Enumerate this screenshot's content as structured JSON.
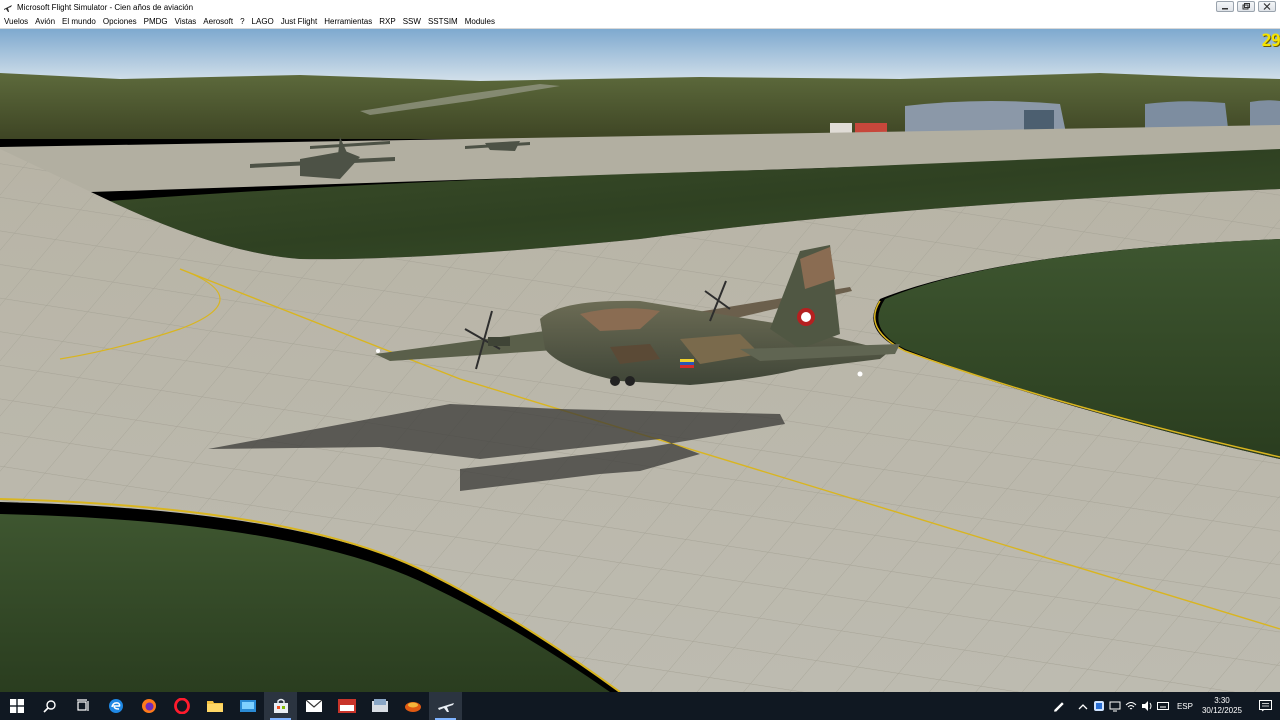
{
  "window": {
    "title": "Microsoft Flight Simulator - Cien años de aviación"
  },
  "menu": {
    "items": [
      "Vuelos",
      "Avión",
      "El mundo",
      "Opciones",
      "PMDG",
      "Vistas",
      "Aerosoft",
      "?",
      "LAGO",
      "Just Flight",
      "Herramientas",
      "RXP",
      "SSW",
      "SSTSIM",
      "Modules"
    ]
  },
  "overlay": {
    "fps": "29"
  },
  "taskbar": {
    "language": "ESP",
    "time": "3:30",
    "date": "30/12/2025",
    "apps": [
      "start-icon",
      "search-icon",
      "task-view-icon",
      "edge-icon",
      "firefox-icon",
      "opera-icon",
      "file-explorer-icon",
      "store-icon",
      "shopping-bag-icon",
      "mail-icon",
      "app-red-icon",
      "app-blue-icon",
      "app-orange-icon",
      "flight-simulator-icon"
    ],
    "tray_icons": [
      "pen-icon",
      "chevron-up-icon",
      "onedrive-icon",
      "network-icon",
      "wifi-icon",
      "speaker-icon",
      "keyboard-icon"
    ]
  },
  "colors": {
    "fps_text": "#f5e400",
    "taskbar_bg": "#101822",
    "sky_top": "#8cb4d8"
  }
}
